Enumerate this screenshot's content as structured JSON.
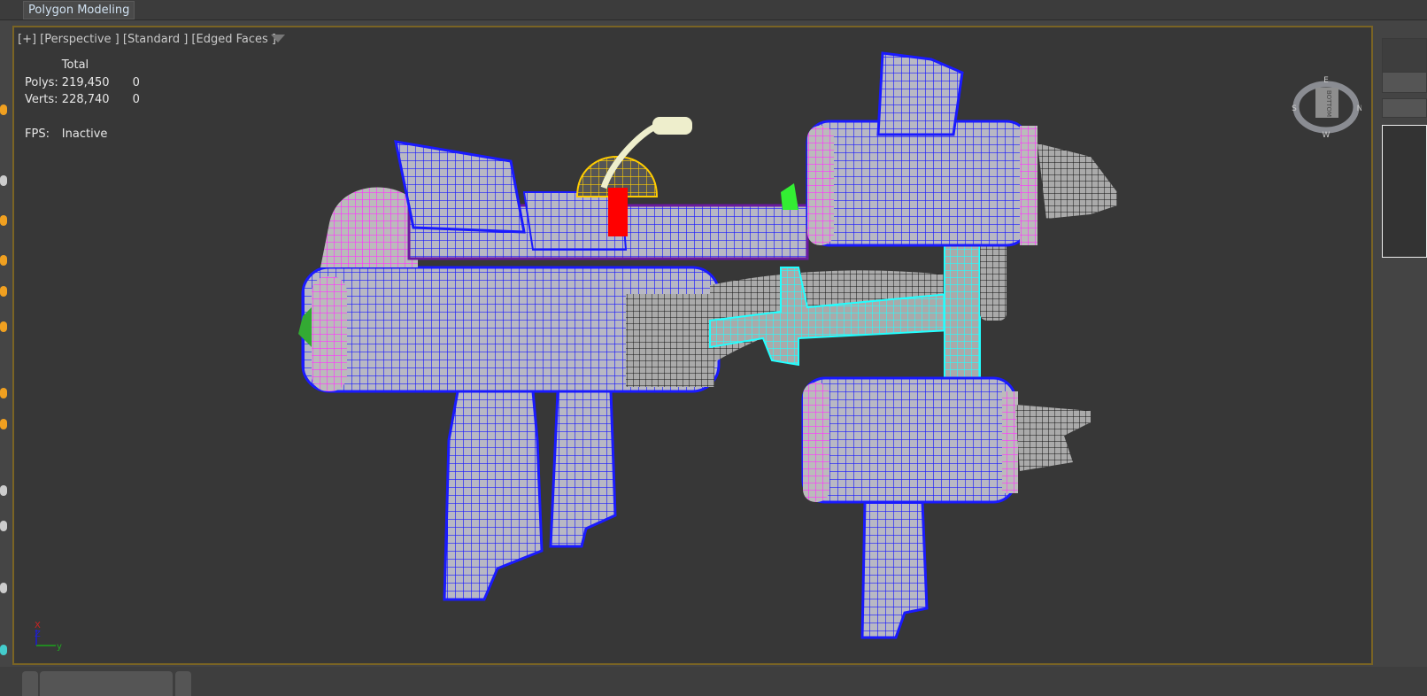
{
  "ribbon": {
    "active_tab": "Polygon Modeling"
  },
  "viewport": {
    "label": "[+] [Perspective ] [Standard ] [Edged Faces ]",
    "stats": {
      "header": "Total",
      "polys_label": "Polys:",
      "polys_total": "219,450",
      "polys_sel": "0",
      "verts_label": "Verts:",
      "verts_total": "228,740",
      "verts_sel": "0",
      "fps_label": "FPS:",
      "fps_value": "Inactive"
    },
    "viewcube": {
      "face": "BOTTOM",
      "n": "N",
      "s": "S",
      "e": "E",
      "w": "W"
    },
    "axis": {
      "x": "X",
      "y": "y",
      "z": "Z"
    }
  },
  "colors": {
    "border": "#7a6424",
    "wire_blue": "#1a1aff",
    "wire_magenta": "#ff33ff",
    "wire_cyan": "#33ffff",
    "wire_purple": "#6a1aa0"
  }
}
